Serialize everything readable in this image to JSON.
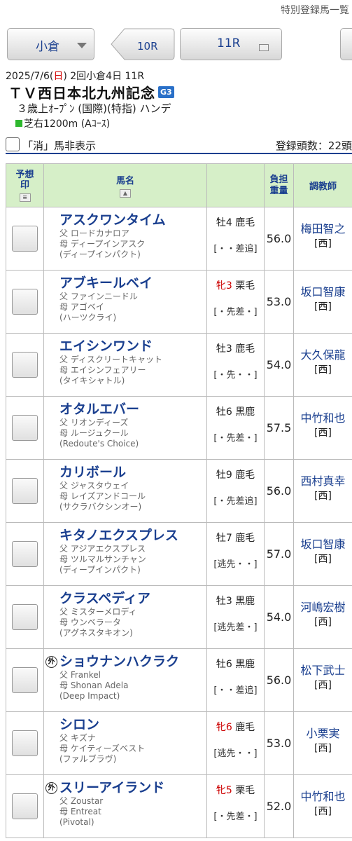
{
  "top_link": "特別登録馬一覧",
  "nav": {
    "venue": "小倉",
    "prev_race": "10R",
    "current_race": "11R"
  },
  "race": {
    "date_prefix": "2025/7/6(",
    "day": "日",
    "date_suffix": ") 2回小倉4日 11R",
    "name": "ＴＶ西日本北九州記念",
    "grade": "G3",
    "conditions": "３歳上ｵｰﾌﾟﾝ (国際)(特指) ハンデ",
    "course": "芝右1200m (Aｺｰｽ)"
  },
  "toggle_label": "「消」馬非表示",
  "entry_count": "登録頭数：22頭",
  "columns": {
    "mark": "予想印",
    "horse": "馬名",
    "weight": "負担重量",
    "trainer": "調教師"
  },
  "horses": [
    {
      "foreign": "",
      "name": "アスクワンタイム",
      "sire": "父 ロードカナロア",
      "dam": "母 ディープインアスク",
      "damsire": "(ディープインパクト)",
      "sex": "牡",
      "age": "4",
      "coat": "鹿毛",
      "style": "[・・差追]",
      "weight": "56.0",
      "trainer": "梅田智之",
      "loc": "[西]"
    },
    {
      "foreign": "",
      "name": "アブキールベイ",
      "sire": "父 ファインニードル",
      "dam": "母 アゴベイ",
      "damsire": "(ハーツクライ)",
      "sex": "牝",
      "age": "3",
      "coat": "栗毛",
      "style": "[・先差・]",
      "weight": "53.0",
      "trainer": "坂口智康",
      "loc": "[西]"
    },
    {
      "foreign": "",
      "name": "エイシンワンド",
      "sire": "父 ディスクリートキャット",
      "dam": "母 エイシンフェアリー",
      "damsire": "(タイキシャトル)",
      "sex": "牡",
      "age": "3",
      "coat": "鹿毛",
      "style": "[・先・・]",
      "weight": "54.0",
      "trainer": "大久保龍",
      "loc": "[西]"
    },
    {
      "foreign": "",
      "name": "オタルエバー",
      "sire": "父 リオンディーズ",
      "dam": "母 ルージュクール",
      "damsire": "(Redoute's Choice)",
      "sex": "牡",
      "age": "6",
      "coat": "黒鹿",
      "style": "[・先差・]",
      "weight": "57.5",
      "trainer": "中竹和也",
      "loc": "[西]"
    },
    {
      "foreign": "",
      "name": "カリボール",
      "sire": "父 ジャスタウェイ",
      "dam": "母 レイズアンドコール",
      "damsire": "(サクラバクシンオー)",
      "sex": "牡",
      "age": "9",
      "coat": "鹿毛",
      "style": "[・先差追]",
      "weight": "56.0",
      "trainer": "西村真幸",
      "loc": "[西]"
    },
    {
      "foreign": "",
      "name": "キタノエクスプレス",
      "sire": "父 アジアエクスプレス",
      "dam": "母 ツルマルサンチャン",
      "damsire": "(ディープインパクト)",
      "sex": "牡",
      "age": "7",
      "coat": "鹿毛",
      "style": "[逃先・・]",
      "weight": "57.0",
      "trainer": "坂口智康",
      "loc": "[西]"
    },
    {
      "foreign": "",
      "name": "クラスペディア",
      "sire": "父 ミスターメロディ",
      "dam": "母 ウンベラータ",
      "damsire": "(アグネスタキオン)",
      "sex": "牡",
      "age": "3",
      "coat": "黒鹿",
      "style": "[逃先差・]",
      "weight": "54.0",
      "trainer": "河嶋宏樹",
      "loc": "[西]"
    },
    {
      "foreign": "外",
      "name": "ショウナンハクラク",
      "sire": "父 Frankel",
      "dam": "母 Shonan Adela",
      "damsire": "(Deep Impact)",
      "sex": "牡",
      "age": "6",
      "coat": "黒鹿",
      "style": "[・・差追]",
      "weight": "56.0",
      "trainer": "松下武士",
      "loc": "[西]"
    },
    {
      "foreign": "",
      "name": "シロン",
      "sire": "父 キズナ",
      "dam": "母 ケイティーズベスト",
      "damsire": "(ファルブラヴ)",
      "sex": "牝",
      "age": "6",
      "coat": "鹿毛",
      "style": "[逃先・・]",
      "weight": "53.0",
      "trainer": "小栗実",
      "loc": "[西]"
    },
    {
      "foreign": "外",
      "name": "スリーアイランド",
      "sire": "父 Zoustar",
      "dam": "母 Entreat",
      "damsire": "(Pivotal)",
      "sex": "牝",
      "age": "5",
      "coat": "栗毛",
      "style": "[・先差・]",
      "weight": "52.0",
      "trainer": "中竹和也",
      "loc": "[西]"
    }
  ]
}
